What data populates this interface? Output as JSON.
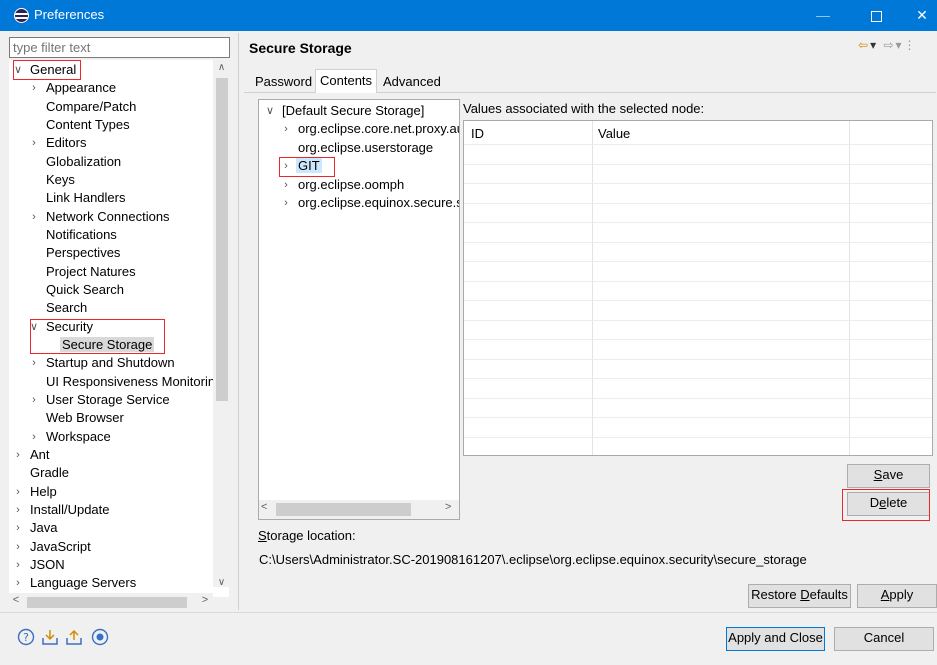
{
  "window": {
    "title": "Preferences",
    "icon": "eclipse-icon",
    "controls": {
      "minimize": "—",
      "maximize": "",
      "close": "✕"
    }
  },
  "filter": {
    "placeholder": "type filter text"
  },
  "tree": [
    {
      "label": "General",
      "depth": 0,
      "toggle": "expanded"
    },
    {
      "label": "Appearance",
      "depth": 1,
      "toggle": "collapsed"
    },
    {
      "label": "Compare/Patch",
      "depth": 1,
      "toggle": "none"
    },
    {
      "label": "Content Types",
      "depth": 1,
      "toggle": "none"
    },
    {
      "label": "Editors",
      "depth": 1,
      "toggle": "collapsed"
    },
    {
      "label": "Globalization",
      "depth": 1,
      "toggle": "none"
    },
    {
      "label": "Keys",
      "depth": 1,
      "toggle": "none"
    },
    {
      "label": "Link Handlers",
      "depth": 1,
      "toggle": "none"
    },
    {
      "label": "Network Connections",
      "depth": 1,
      "toggle": "collapsed"
    },
    {
      "label": "Notifications",
      "depth": 1,
      "toggle": "none"
    },
    {
      "label": "Perspectives",
      "depth": 1,
      "toggle": "none"
    },
    {
      "label": "Project Natures",
      "depth": 1,
      "toggle": "none"
    },
    {
      "label": "Quick Search",
      "depth": 1,
      "toggle": "none"
    },
    {
      "label": "Search",
      "depth": 1,
      "toggle": "none"
    },
    {
      "label": "Security",
      "depth": 1,
      "toggle": "expanded"
    },
    {
      "label": "Secure Storage",
      "depth": 2,
      "toggle": "none",
      "selected": true
    },
    {
      "label": "Startup and Shutdown",
      "depth": 1,
      "toggle": "collapsed"
    },
    {
      "label": "UI Responsiveness Monitoring",
      "depth": 1,
      "toggle": "none"
    },
    {
      "label": "User Storage Service",
      "depth": 1,
      "toggle": "collapsed"
    },
    {
      "label": "Web Browser",
      "depth": 1,
      "toggle": "none"
    },
    {
      "label": "Workspace",
      "depth": 1,
      "toggle": "collapsed"
    },
    {
      "label": "Ant",
      "depth": 0,
      "toggle": "collapsed"
    },
    {
      "label": "Gradle",
      "depth": 0,
      "toggle": "none"
    },
    {
      "label": "Help",
      "depth": 0,
      "toggle": "collapsed"
    },
    {
      "label": "Install/Update",
      "depth": 0,
      "toggle": "collapsed"
    },
    {
      "label": "Java",
      "depth": 0,
      "toggle": "collapsed"
    },
    {
      "label": "JavaScript",
      "depth": 0,
      "toggle": "collapsed"
    },
    {
      "label": "JSON",
      "depth": 0,
      "toggle": "collapsed"
    },
    {
      "label": "Language Servers",
      "depth": 0,
      "toggle": "collapsed"
    }
  ],
  "page": {
    "title": "Secure Storage",
    "tabs": [
      "Password",
      "Contents",
      "Advanced"
    ],
    "active_tab": "Contents"
  },
  "storage_tree": [
    {
      "label": "[Default Secure Storage]",
      "depth": 0,
      "toggle": "expanded"
    },
    {
      "label": "org.eclipse.core.net.proxy.auth",
      "depth": 1,
      "toggle": "collapsed"
    },
    {
      "label": "org.eclipse.userstorage",
      "depth": 1,
      "toggle": "none"
    },
    {
      "label": "GIT",
      "depth": 1,
      "toggle": "collapsed",
      "selected": true
    },
    {
      "label": "org.eclipse.oomph",
      "depth": 1,
      "toggle": "collapsed"
    },
    {
      "label": "org.eclipse.equinox.secure.storage",
      "depth": 1,
      "toggle": "collapsed"
    }
  ],
  "values": {
    "label": "Values associated with the selected node:",
    "columns": [
      "ID",
      "Value"
    ],
    "rows": []
  },
  "buttons": {
    "save": {
      "pre": "",
      "mnemonic": "S",
      "post": "ave"
    },
    "delete": {
      "pre": "D",
      "mnemonic": "e",
      "post": "lete"
    },
    "restore": {
      "pre": "Restore ",
      "mnemonic": "D",
      "post": "efaults"
    },
    "apply": {
      "pre": "",
      "mnemonic": "A",
      "post": "pply"
    },
    "apply_close": "Apply and Close",
    "cancel": "Cancel"
  },
  "storage_location": {
    "label_pre": "",
    "label_mnemonic": "S",
    "label_post": "torage location:",
    "path": "C:\\Users\\Administrator.SC-201908161207\\.eclipse\\org.eclipse.equinox.security\\secure_storage"
  },
  "footer_icons": [
    "help-icon",
    "import-icon",
    "export-icon",
    "oomph-sync-icon"
  ],
  "colors": {
    "titlebar": "#0078d7",
    "highlight_box": "#e8282e",
    "selection": "#cce8ff"
  }
}
